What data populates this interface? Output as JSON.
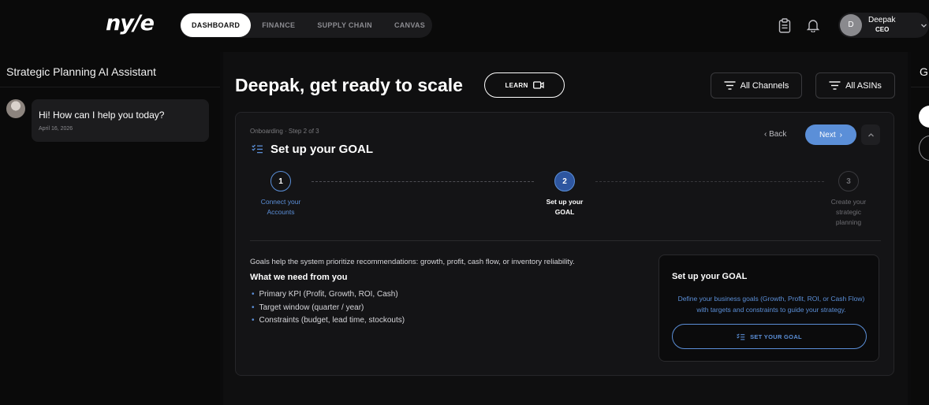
{
  "header": {
    "logo": "ny/e",
    "nav": [
      {
        "label": "DASHBOARD",
        "active": true
      },
      {
        "label": "FINANCE",
        "active": false
      },
      {
        "label": "SUPPLY CHAIN",
        "active": false
      },
      {
        "label": "CANVAS",
        "active": false
      }
    ],
    "icons": [
      "clipboard-icon",
      "bell-icon"
    ],
    "user": {
      "initial": "D",
      "name": "Deepak",
      "role": "CEO"
    }
  },
  "assistant": {
    "title": "Strategic Planning AI Assistant",
    "message": "Hi! How can I help you today?",
    "date": "April 16, 2026"
  },
  "main": {
    "headline": "Deepak, get ready to scale",
    "learn_label": "LEARN",
    "filters": {
      "channels": "All Channels",
      "asins": "All ASINs"
    },
    "onboarding": {
      "crumb": "Onboarding · Step 2 of 3",
      "title": "Set up your GOAL",
      "back_label": "Back",
      "next_label": "Next",
      "steps": [
        {
          "num": "1",
          "label_l1": "Connect your",
          "label_l2": "Accounts",
          "label_l3": "",
          "state": "done"
        },
        {
          "num": "2",
          "label_l1": "Set up your",
          "label_l2": "GOAL",
          "label_l3": "",
          "state": "active"
        },
        {
          "num": "3",
          "label_l1": "Create your",
          "label_l2": "strategic",
          "label_l3": "planning",
          "state": "pending"
        }
      ],
      "intro": "Goals help the system prioritize recommendations: growth, profit, cash flow, or inventory reliability.",
      "need_title": "What we need from you",
      "needs": [
        "Primary KPI (Profit, Growth, ROI, Cash)",
        "Target window (quarter / year)",
        "Constraints (budget, lead time, stockouts)"
      ],
      "goal_card": {
        "title": "Set up your GOAL",
        "description": "Define your business goals (Growth, Profit, ROI, or Cash Flow) with targets and constraints to guide your strategy.",
        "button_label": "SET YOUR GOAL"
      }
    }
  },
  "right_panel": {
    "title_partial": "G"
  },
  "colors": {
    "accent": "#5b8fd8",
    "background": "#0b0b0c",
    "card": "#141416"
  }
}
